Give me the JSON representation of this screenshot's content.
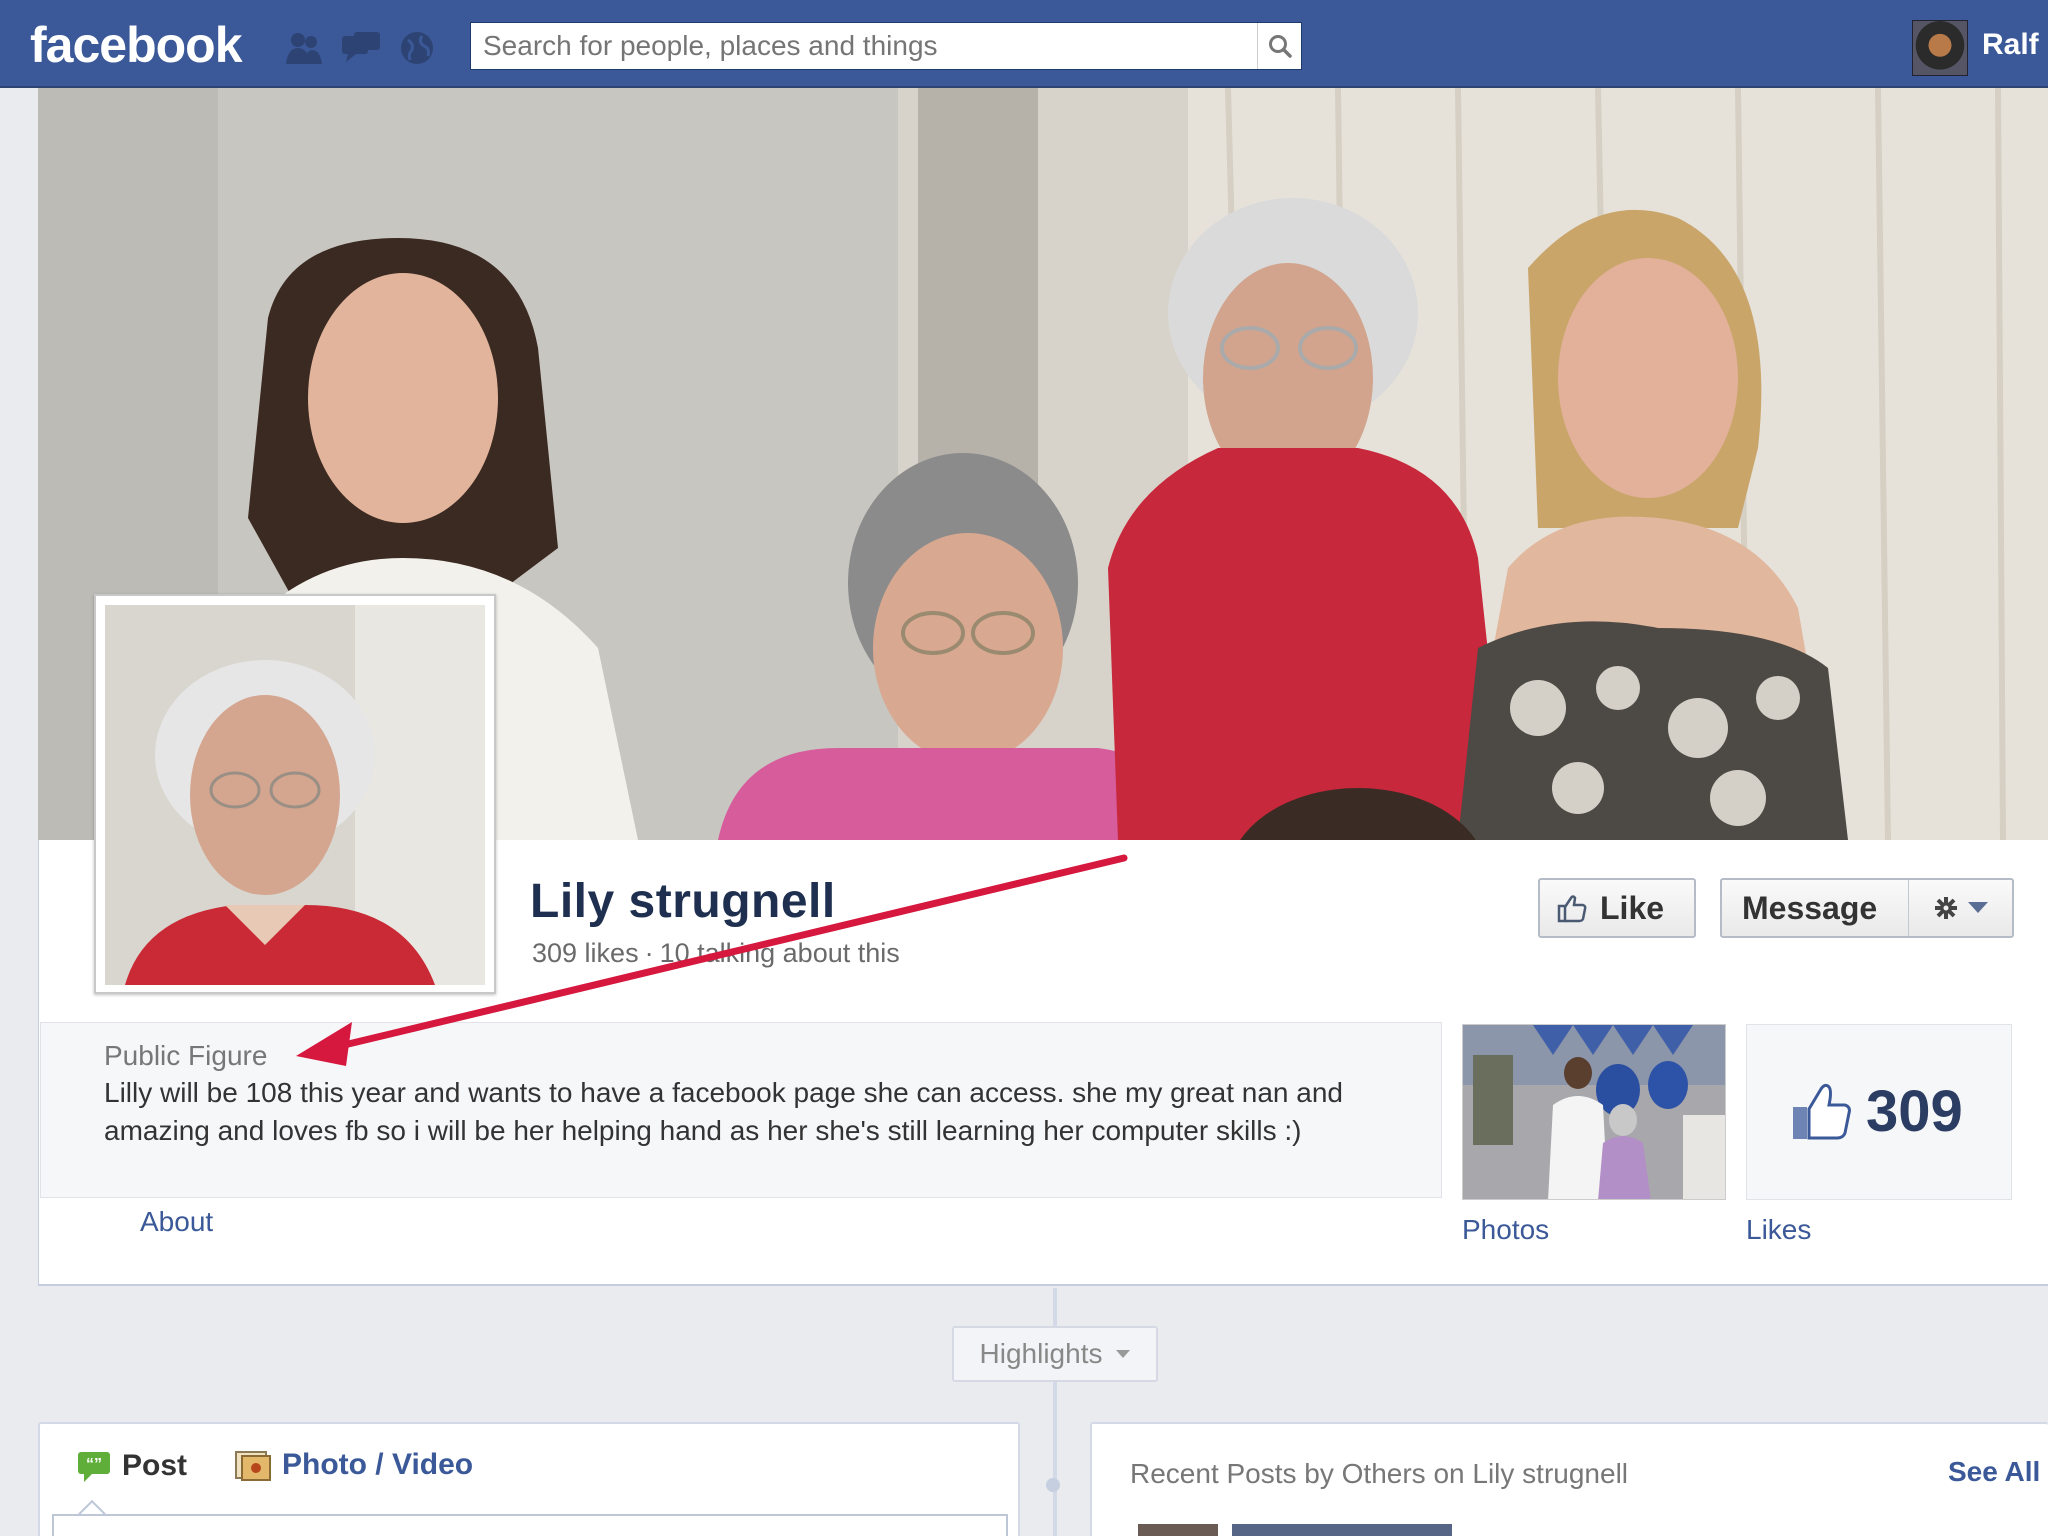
{
  "topbar": {
    "logo": "facebook",
    "search_placeholder": "Search for people, places and things",
    "user_name": "Ralf",
    "icons": [
      "friends-icon",
      "messages-icon",
      "notifications-globe-icon",
      "search-icon"
    ],
    "brand_color": "#3b5998"
  },
  "page": {
    "name": "Lily strugnell",
    "likes_summary": "309 likes",
    "separator": "·",
    "talking_about": "10 talking about this",
    "like_button": "Like",
    "message_button": "Message",
    "category": "Public Figure",
    "about": "Lilly will be 108 this year and wants to have a facebook page she can access. she my great nan and amazing and loves fb so i will be her helping hand as her she's still learning her computer skills :)",
    "about_link": "About",
    "photos_link": "Photos",
    "likes_count": "309",
    "likes_link": "Likes"
  },
  "timeline": {
    "highlights": "Highlights",
    "composer_tabs": [
      "Post",
      "Photo / Video"
    ],
    "recent_posts_title": "Recent Posts by Others on Lily strugnell",
    "see_all": "See All"
  },
  "annotation": {
    "color": "#d6173e"
  }
}
